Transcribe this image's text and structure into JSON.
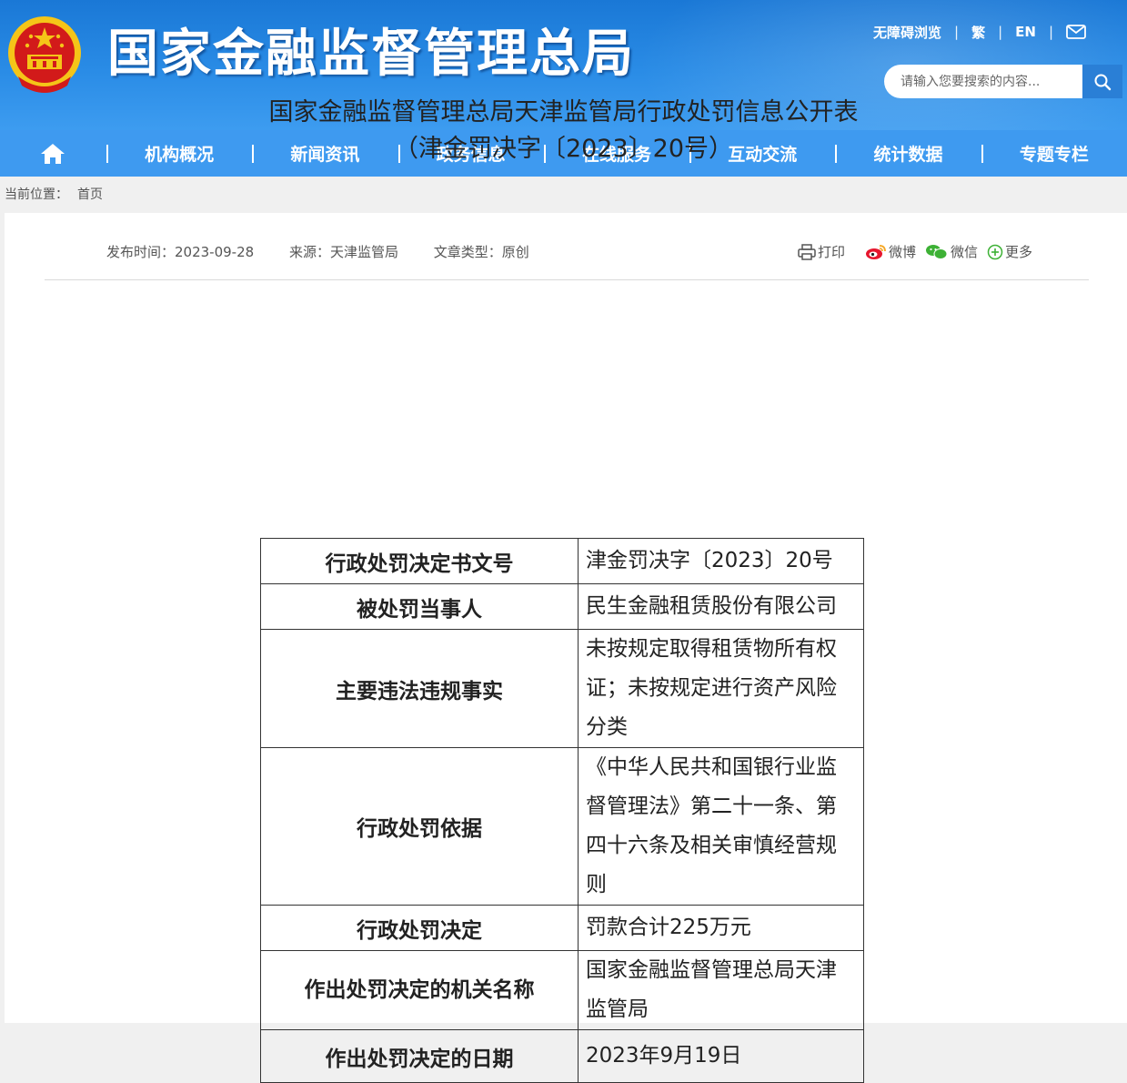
{
  "header": {
    "site_title": "国家金融监督管理总局",
    "links": {
      "accessibility": "无障碍浏览",
      "traditional": "繁",
      "english": "EN"
    },
    "search_placeholder": "请输入您要搜索的内容..."
  },
  "nav": {
    "items": [
      "机构概况",
      "新闻资讯",
      "政务信息",
      "在线服务",
      "互动交流",
      "统计数据",
      "专题专栏"
    ]
  },
  "breadcrumb": {
    "label": "当前位置：",
    "home": "首页"
  },
  "article": {
    "meta": {
      "date": "发布时间：2023-09-28",
      "source": "来源：天津监管局",
      "type": "文章类型：原创"
    },
    "share": {
      "print": "打印",
      "weibo": "微博",
      "wechat": "微信",
      "more": "更多"
    },
    "title_line1": "国家金融监督管理总局天津监管局行政处罚信息公开表",
    "title_line2": "（津金罚决字〔2023〕20号）"
  },
  "penalty_table": {
    "rows": [
      {
        "key": "行政处罚决定书文号",
        "value": "津金罚决字〔2023〕20号"
      },
      {
        "key": "被处罚当事人",
        "value": "民生金融租赁股份有限公司"
      },
      {
        "key": "主要违法违规事实",
        "value": "未按规定取得租赁物所有权证；未按规定进行资产风险分类"
      },
      {
        "key": "行政处罚依据",
        "value": "《中华人民共和国银行业监督管理法》第二十一条、第四十六条及相关审慎经营规则"
      },
      {
        "key": "行政处罚决定",
        "value": "罚款合计225万元"
      },
      {
        "key": "作出处罚决定的机关名称",
        "value": "国家金融监督管理总局天津监管局"
      },
      {
        "key": "作出处罚决定的日期",
        "value": "2023年9月19日"
      }
    ]
  },
  "colors": {
    "header_blue": "#1a78d6",
    "nav_blue": "#3e9af0",
    "emblem_red": "#d21a1a",
    "emblem_gold": "#f5c518"
  }
}
